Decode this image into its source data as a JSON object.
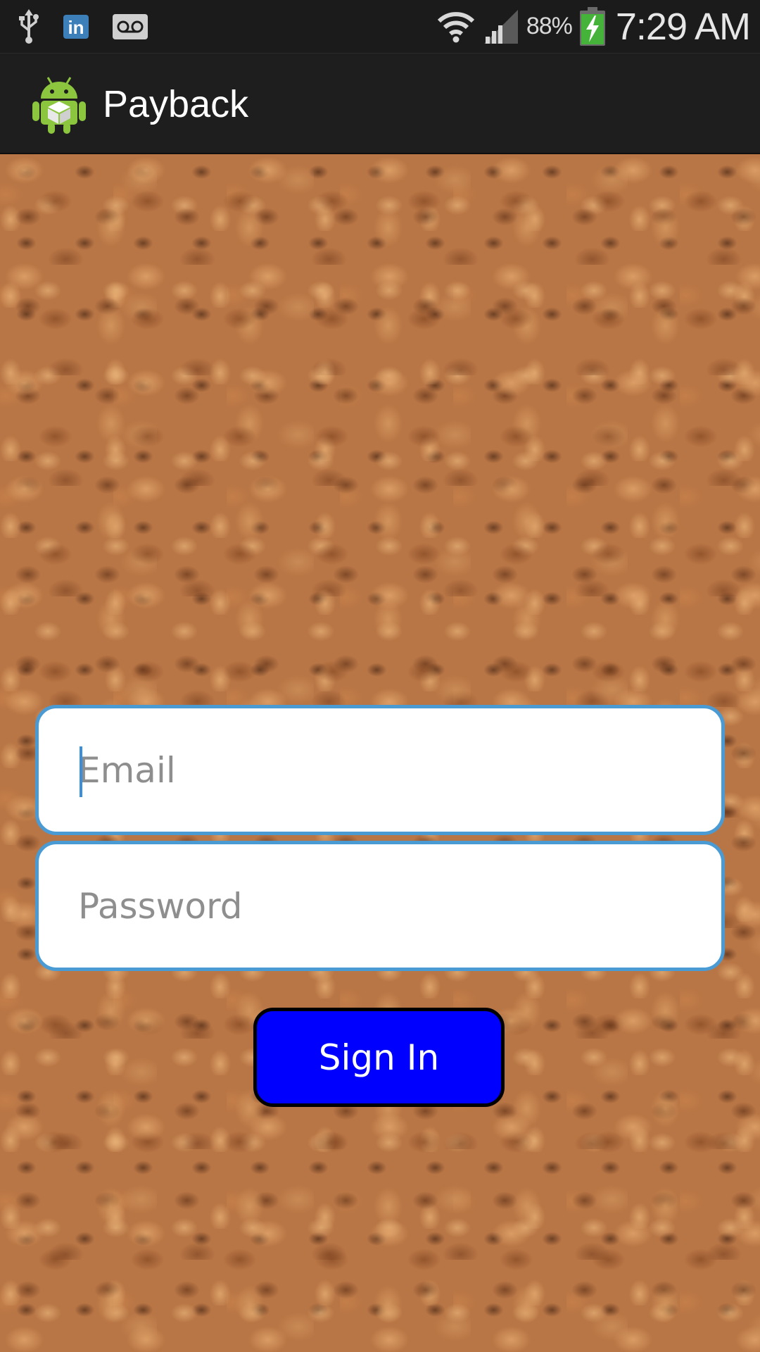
{
  "status_bar": {
    "left_icons": [
      "usb-icon",
      "linkedin-icon",
      "voicemail-icon"
    ],
    "right_icons": [
      "wifi-icon",
      "signal-icon",
      "battery-charging-icon"
    ],
    "linkedin_text": "in",
    "battery_percent": "88%",
    "time": "7:29 AM"
  },
  "action_bar": {
    "app_icon": "android-app-icon",
    "title": "Payback"
  },
  "login": {
    "email_placeholder": "Email",
    "password_placeholder": "Password",
    "sign_in_label": "Sign In"
  },
  "colors": {
    "status_bar_bg": "#1b1b1b",
    "action_bar_bg": "#1e1e1e",
    "field_border": "#4a9ad4",
    "button_bg": "#0000ff",
    "button_border": "#000000",
    "background_texture": "cork"
  }
}
